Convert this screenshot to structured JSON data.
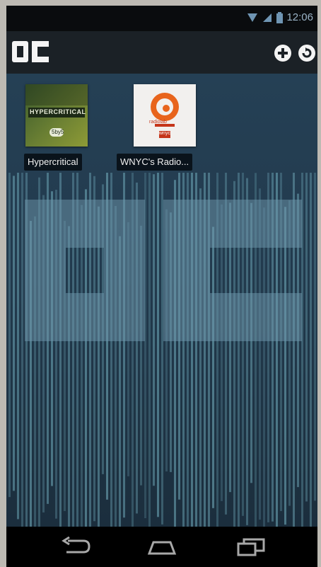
{
  "status_bar": {
    "time": "12:06"
  },
  "action_bar": {
    "app_logo_text": "OC",
    "add_icon": "plus-circle-icon",
    "refresh_icon": "refresh-icon"
  },
  "podcasts": [
    {
      "label": "Hypercritical",
      "art_text": "HYPERCRITICAL",
      "art_sub": "5by5"
    },
    {
      "label": "WNYC's Radio...",
      "art_text": "radiolab",
      "art_sub": "wnyc"
    }
  ],
  "watermark_text": "OC",
  "nav_bar": {
    "back_icon": "back-icon",
    "home_icon": "home-icon",
    "recents_icon": "recents-icon"
  },
  "colors": {
    "background": "#254055",
    "bars": "#6fa8b8",
    "accent_orange": "#e8641c"
  }
}
